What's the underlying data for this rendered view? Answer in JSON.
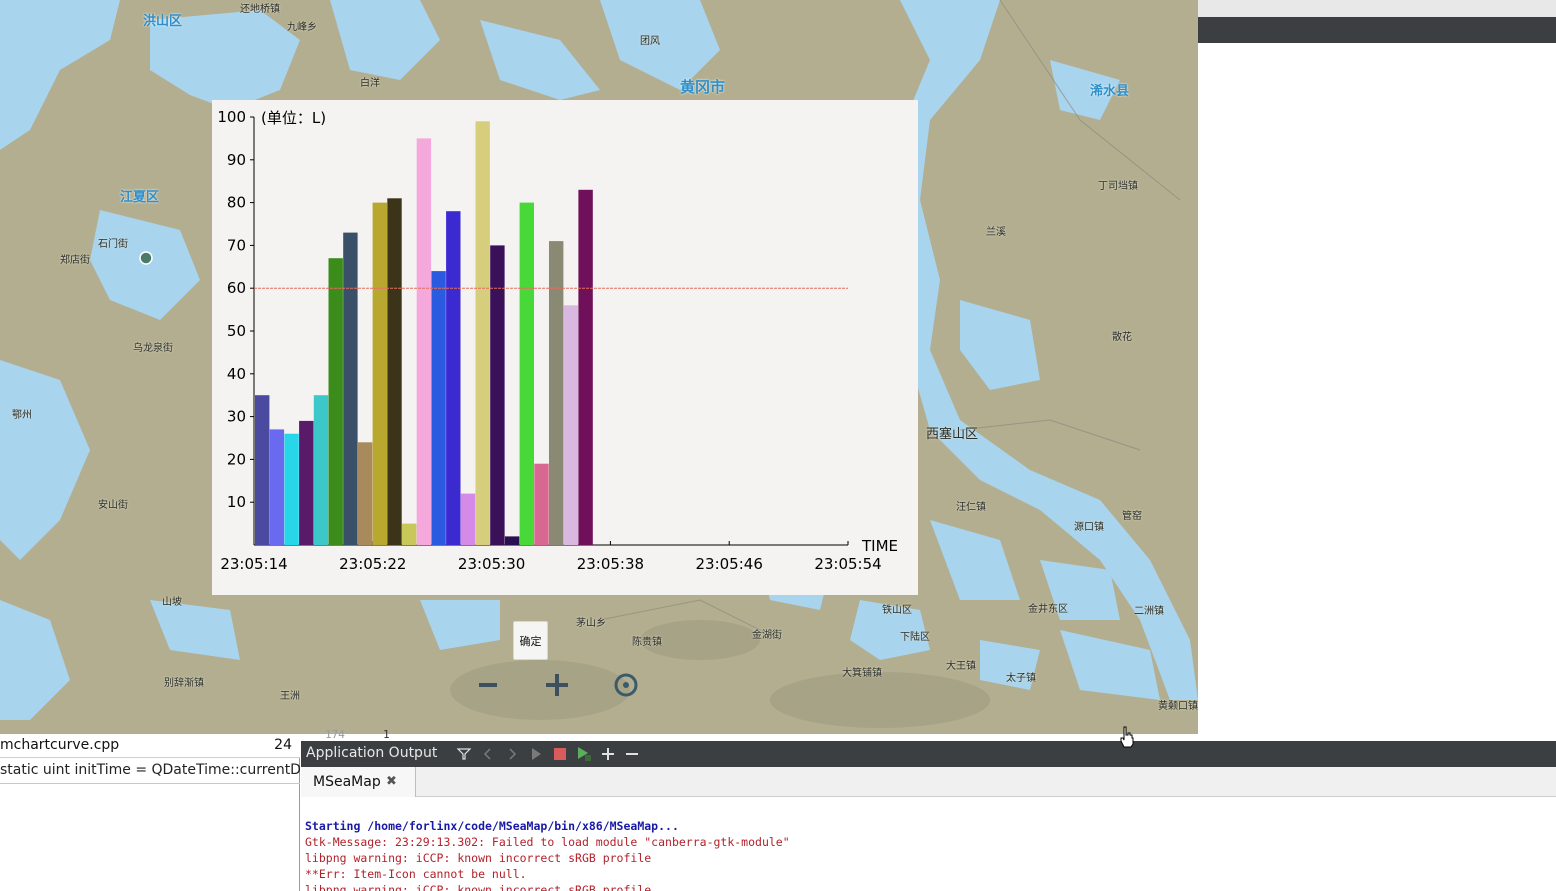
{
  "map": {
    "places": [
      {
        "name": "洪山区",
        "cls": "mid"
      },
      {
        "name": "黄冈市",
        "cls": "big"
      },
      {
        "name": "浠水县",
        "cls": "mid"
      },
      {
        "name": "江夏区",
        "cls": "mid"
      },
      {
        "name": "西塞山区",
        "cls": "dist"
      },
      {
        "name": "丁司垱镇",
        "cls": ""
      },
      {
        "name": "石门街",
        "cls": ""
      },
      {
        "name": "郑店街",
        "cls": ""
      },
      {
        "name": "乌龙泉街",
        "cls": ""
      },
      {
        "name": "安山街",
        "cls": ""
      },
      {
        "name": "山坡",
        "cls": ""
      },
      {
        "name": "别辞渐镇",
        "cls": ""
      },
      {
        "name": "鄂州",
        "cls": ""
      },
      {
        "name": "王洲",
        "cls": ""
      },
      {
        "name": "茅山乡",
        "cls": ""
      },
      {
        "name": "陈贵镇",
        "cls": ""
      },
      {
        "name": "金湖街",
        "cls": ""
      },
      {
        "name": "大箕铺镇",
        "cls": ""
      },
      {
        "name": "大王镇",
        "cls": ""
      },
      {
        "name": "太子镇",
        "cls": ""
      },
      {
        "name": "黄颡口镇",
        "cls": ""
      },
      {
        "name": "汪仁镇",
        "cls": ""
      },
      {
        "name": "源口镇",
        "cls": ""
      },
      {
        "name": "金井东区",
        "cls": ""
      },
      {
        "name": "二洲镇",
        "cls": ""
      },
      {
        "name": "兰溪",
        "cls": ""
      },
      {
        "name": "散花",
        "cls": ""
      },
      {
        "name": "九峰乡",
        "cls": ""
      },
      {
        "name": "团风",
        "cls": ""
      },
      {
        "name": "白洋",
        "cls": ""
      },
      {
        "name": "管窑",
        "cls": ""
      },
      {
        "name": "下陆区",
        "cls": ""
      },
      {
        "name": "铁山区",
        "cls": ""
      },
      {
        "name": "还地桥镇",
        "cls": ""
      }
    ],
    "confirm_label": "确定"
  },
  "chart_data": {
    "type": "bar",
    "unit_label": "(单位：L)",
    "x_axis_label": "TIME",
    "x_ticks": [
      "23:05:14",
      "23:05:22",
      "23:05:30",
      "23:05:38",
      "23:05:46",
      "23:05:54"
    ],
    "y_ticks": [
      "10",
      "20",
      "30",
      "40",
      "50",
      "60",
      "70",
      "80",
      "90",
      "100"
    ],
    "ylim": [
      0,
      100
    ],
    "threshold": 60,
    "threshold_color": "#e07060",
    "bars": [
      {
        "value": 35,
        "color": "#4a4aa0"
      },
      {
        "value": 27,
        "color": "#6a6af0"
      },
      {
        "value": 26,
        "color": "#27d6e8"
      },
      {
        "value": 29,
        "color": "#5a1a6a"
      },
      {
        "value": 35,
        "color": "#3cc8c8"
      },
      {
        "value": 67,
        "color": "#3c8c1c"
      },
      {
        "value": 73,
        "color": "#3a5068"
      },
      {
        "value": 24,
        "color": "#a88a5c"
      },
      {
        "value": 80,
        "color": "#b8a830"
      },
      {
        "value": 81,
        "color": "#3c3418"
      },
      {
        "value": 5,
        "color": "#c8c85a"
      },
      {
        "value": 95,
        "color": "#f5a8dc"
      },
      {
        "value": 64,
        "color": "#2a5ae0"
      },
      {
        "value": 78,
        "color": "#3a2ad0"
      },
      {
        "value": 12,
        "color": "#d68ae8"
      },
      {
        "value": 99,
        "color": "#d6ce7c"
      },
      {
        "value": 70,
        "color": "#3a1058"
      },
      {
        "value": 2,
        "color": "#2a1050"
      },
      {
        "value": 80,
        "color": "#48d838"
      },
      {
        "value": 19,
        "color": "#d86890"
      },
      {
        "value": 71,
        "color": "#8a8a74"
      },
      {
        "value": 56,
        "color": "#d8b8e0"
      },
      {
        "value": 83,
        "color": "#70105a"
      }
    ]
  },
  "editor": {
    "file_name": "mchartcurve.cpp",
    "line_number": "24",
    "code_line": "static uint initTime = QDateTime::currentDateTime().toTime_t();",
    "gutter_a": "174",
    "gutter_b": "1"
  },
  "output": {
    "panel_title": "Application Output",
    "tab_label": "MSeaMap",
    "lines": [
      {
        "text": "Starting /home/forlinx/code/MSeaMap/bin/x86/MSeaMap...",
        "kind": "start"
      },
      {
        "text": "Gtk-Message: 23:29:13.302: Failed to load module \"canberra-gtk-module\"",
        "kind": "err"
      },
      {
        "text": "libpng warning: iCCP: known incorrect sRGB profile",
        "kind": "err"
      },
      {
        "text": "**Err: Item-Icon cannot be null.",
        "kind": "err"
      },
      {
        "text": "libpng warning: iCCP: known incorrect sRGB profile",
        "kind": "err"
      }
    ]
  }
}
